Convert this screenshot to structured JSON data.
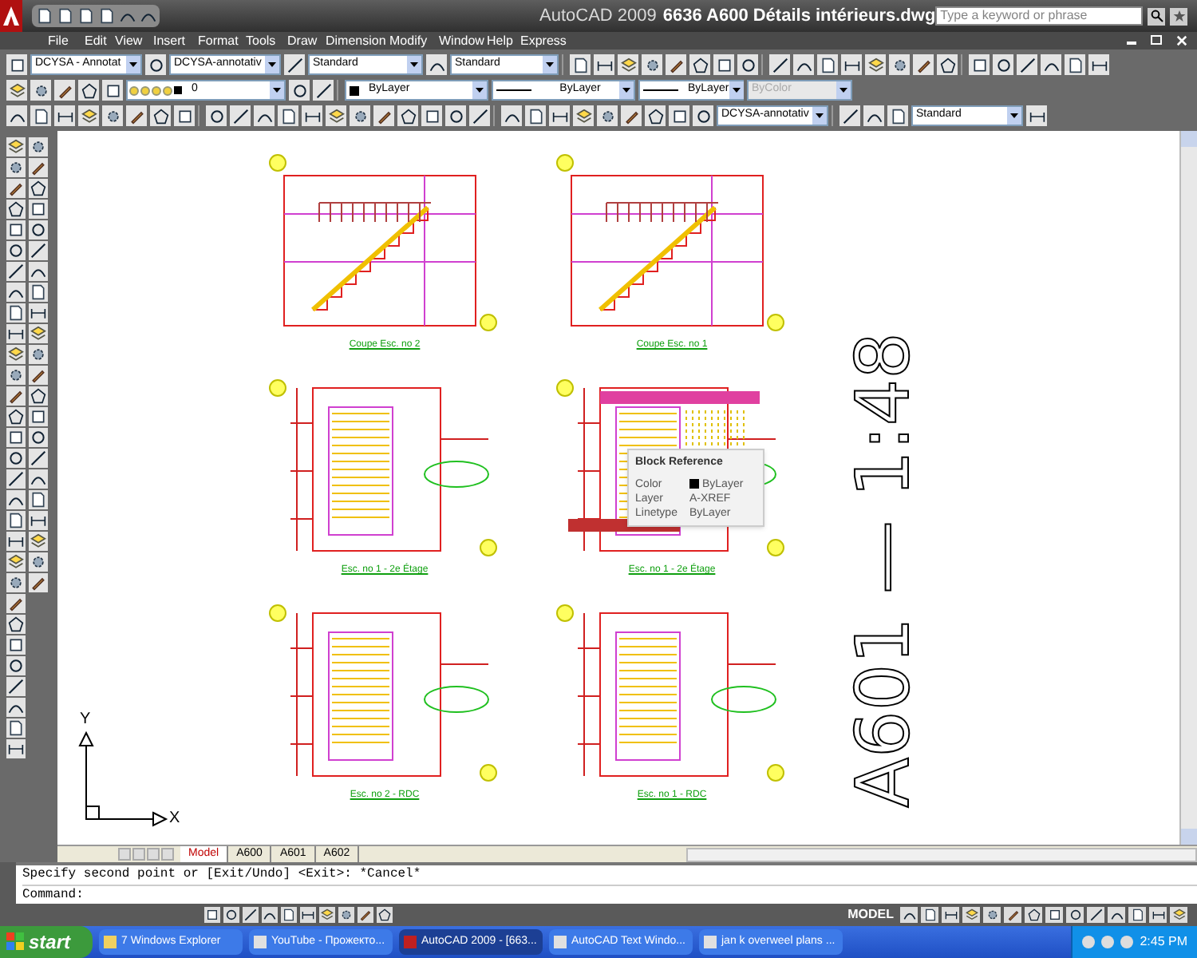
{
  "window": {
    "title_app": "AutoCAD 2009",
    "title_file": "6636 A600 Détails intérieurs.dwg",
    "search": {
      "placeholder": "Type a keyword or phrase"
    }
  },
  "menu": [
    "File",
    "Edit",
    "View",
    "Insert",
    "Format",
    "Tools",
    "Draw",
    "Dimension",
    "Modify",
    "Window",
    "Help",
    "Express"
  ],
  "toolbar_combos": [
    {
      "value": "DCYSA - Annotat",
      "disabled": false
    },
    {
      "value": "DCYSA-annotativ",
      "disabled": false
    },
    {
      "value": "Standard",
      "disabled": false
    },
    {
      "value": "Standard",
      "disabled": false
    },
    {
      "value": "0",
      "disabled": false
    },
    {
      "value": "ByLayer",
      "disabled": false
    },
    {
      "value": "ByLayer",
      "disabled": false
    },
    {
      "value": "ByLayer",
      "disabled": false
    },
    {
      "value": "ByColor",
      "disabled": true
    },
    {
      "value": "DCYSA-annotativ",
      "disabled": false
    },
    {
      "value": "Standard",
      "disabled": false
    }
  ],
  "drawing": {
    "sheet_text": "A601 — 1:48",
    "axis_x": "X",
    "axis_y": "Y",
    "views": [
      {
        "kind": "section",
        "label": "Coupe Esc. no 2"
      },
      {
        "kind": "section",
        "label": "Coupe Esc. no 1"
      },
      {
        "kind": "plan",
        "label": "Esc. no 1 - 2e Étage"
      },
      {
        "kind": "plan_hatched",
        "label": "Esc. no 1 - 2e Étage"
      },
      {
        "kind": "plan",
        "label": "Esc. no 2 - RDC"
      },
      {
        "kind": "plan",
        "label": "Esc. no 1 - RDC"
      }
    ],
    "tooltip": {
      "title": "Block Reference",
      "rows": [
        {
          "kind": "color",
          "label": "Color",
          "value": "ByLayer"
        },
        {
          "kind": "text",
          "label": "Layer",
          "value": "A-XREF"
        },
        {
          "kind": "text",
          "label": "Linetype",
          "value": "ByLayer"
        }
      ]
    }
  },
  "layout_tabs": [
    {
      "label": "Model",
      "selected": true
    },
    {
      "label": "A600",
      "selected": false
    },
    {
      "label": "A601",
      "selected": false
    },
    {
      "label": "A602",
      "selected": false
    }
  ],
  "command_lines": [
    "Specify second point or [Exit/Undo] <Exit>: *Cancel*",
    "Command:"
  ],
  "status_bar": {
    "space": "MODEL"
  },
  "taskbar": {
    "start": "start",
    "tasks": [
      {
        "label": "7 Windows Explorer",
        "selected": false
      },
      {
        "label": "YouTube - Прожекто...",
        "selected": false
      },
      {
        "label": "AutoCAD 2009 - [663...",
        "selected": true
      },
      {
        "label": "AutoCAD Text Windo...",
        "selected": false
      },
      {
        "label": "jan k overweel plans ...",
        "selected": false
      }
    ],
    "clock": "2:45 PM"
  }
}
